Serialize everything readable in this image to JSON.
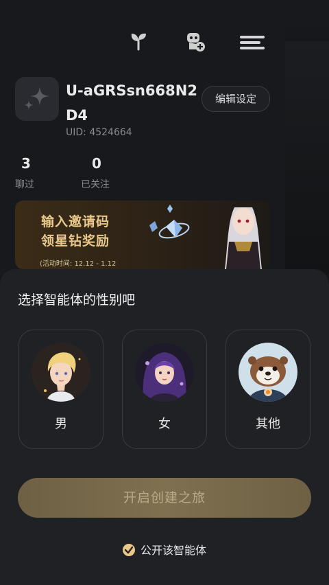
{
  "profile": {
    "username": "U-aGRSsn668N2D4",
    "uid": "UID: 4524664",
    "edit_label": "编辑设定",
    "stats": [
      {
        "value": "3",
        "label": "聊过"
      },
      {
        "value": "0",
        "label": "已关注"
      }
    ]
  },
  "banner": {
    "line1": "输入邀请码",
    "line2": "领星钻奖励",
    "date": "(活动时间: 12.12 - 1.12"
  },
  "sheet": {
    "title": "选择智能体的性别吧",
    "options": [
      {
        "label": "男",
        "icon": "boy-avatar"
      },
      {
        "label": "女",
        "icon": "girl-avatar"
      },
      {
        "label": "其他",
        "icon": "otter-avatar"
      }
    ],
    "create_label": "开启创建之旅",
    "public_label": "公开该智能体"
  },
  "colors": {
    "accent_gold": "#e9c889",
    "sheet_bg": "#202124",
    "button_bg": "#7a6c4c"
  }
}
